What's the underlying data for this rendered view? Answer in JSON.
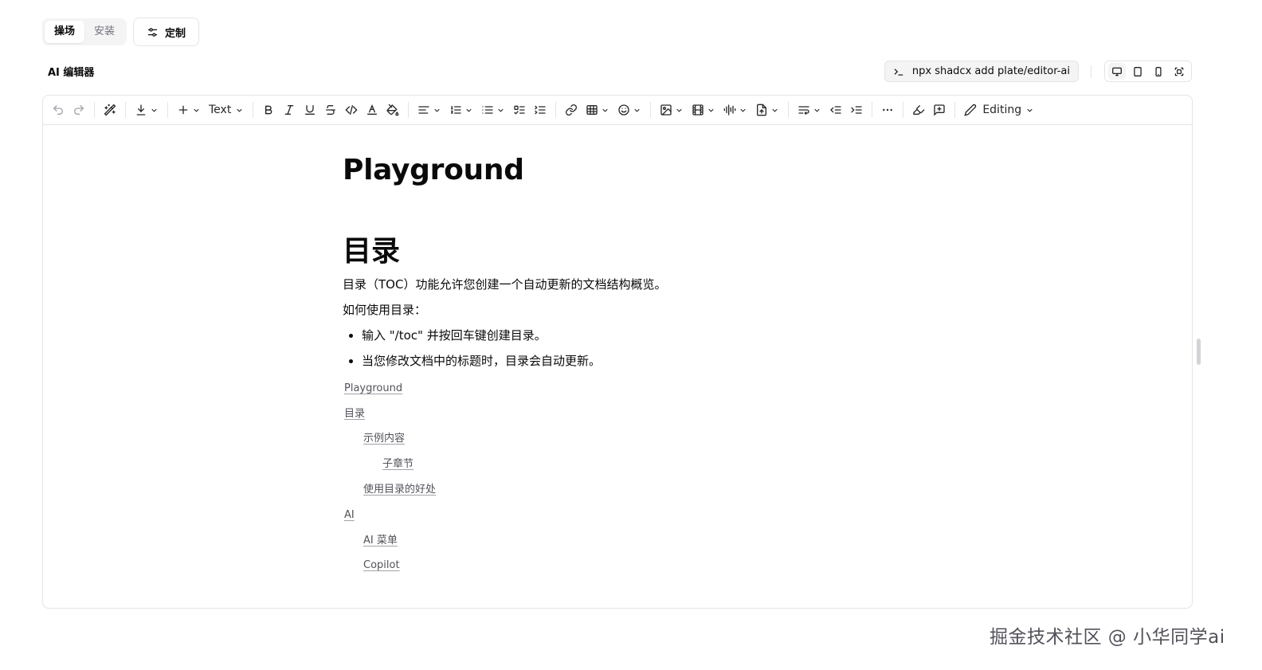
{
  "top_tabs": {
    "items": [
      "操场",
      "安装"
    ],
    "active_index": 0,
    "customize_label": "定制"
  },
  "header": {
    "title": "AI 编辑器",
    "command": "npx shadcx add plate/editor-ai"
  },
  "toolbar": {
    "text_type_label": "Text",
    "mode_label": "Editing"
  },
  "document": {
    "title": "Playground",
    "toc_heading": "目录",
    "intro": "目录（TOC）功能允许您创建一个自动更新的文档结构概览。",
    "howto": "如何使用目录：",
    "bullets": [
      "输入 \"/toc\" 并按回车键创建目录。",
      "当您修改文档中的标题时，目录会自动更新。"
    ],
    "toc": [
      {
        "label": "Playground",
        "level": 1
      },
      {
        "label": "目录",
        "level": 1
      },
      {
        "label": "示例内容",
        "level": 2
      },
      {
        "label": "子章节",
        "level": 3
      },
      {
        "label": "使用目录的好处",
        "level": 2
      },
      {
        "label": "AI",
        "level": 1
      },
      {
        "label": "AI 菜单",
        "level": 2
      },
      {
        "label": "Copilot",
        "level": 2
      }
    ]
  },
  "watermark": "掘金技术社区 @ 小华同学ai",
  "colors": {
    "border": "#e4e4e7",
    "muted": "#f4f4f5",
    "text": "#0a0a0a",
    "link": "#52525b"
  }
}
